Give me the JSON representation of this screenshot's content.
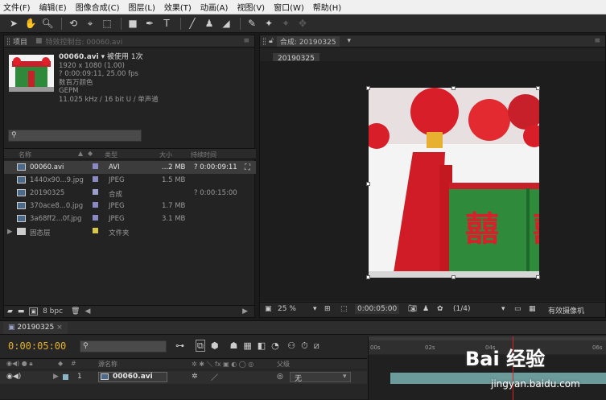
{
  "menubar": {
    "items": [
      "文件(F)",
      "编辑(E)",
      "图像合成(C)",
      "图层(L)",
      "效果(T)",
      "动画(A)",
      "视图(V)",
      "窗口(W)",
      "帮助(H)"
    ]
  },
  "toolbar": {
    "tools": [
      "selection-tool-icon",
      "hand-tool-icon",
      "zoom-tool-icon",
      "rotate-tool-icon",
      "camera-tool-icon",
      "pan-behind-tool-icon",
      "rectangle-tool-icon",
      "pen-tool-icon",
      "type-tool-icon",
      "brush-tool-icon",
      "clone-stamp-tool-icon",
      "eraser-tool-icon",
      "roto-brush-tool-icon",
      "puppet-tool-icon"
    ],
    "type_glyph": "T"
  },
  "project": {
    "tab_project": "项目",
    "tab_effects": "特效控制台: 00060.avi",
    "selected": {
      "name": "00060.avi",
      "used": "▾ 被使用 1次",
      "lines": [
        "1920 x 1080 (1.00)",
        "? 0:00:09:11, 25.00 fps",
        "数百万颜色",
        "GEPM",
        "11.025 kHz / 16 bit U / 单声道"
      ]
    },
    "search_icon": "search-icon",
    "columns": {
      "name": "名称",
      "type": "类型",
      "size": "大小",
      "duration": "持续时间"
    },
    "items": [
      {
        "name": "00060.avi",
        "type": "AVI",
        "size": "...2 MB",
        "duration": "? 0:00:09:11",
        "color": "#8a8ac0"
      },
      {
        "name": "1440x90...9.jpg",
        "type": "JPEG",
        "size": "1.5 MB",
        "duration": "",
        "color": "#8a8ac0"
      },
      {
        "name": "20190325",
        "type": "合成",
        "size": "",
        "duration": "? 0:00:15:00",
        "color": "#9aa0c8"
      },
      {
        "name": "370ace8...0.jpg",
        "type": "JPEG",
        "size": "1.7 MB",
        "duration": "",
        "color": "#8a8ac0"
      },
      {
        "name": "3a68ff2...0f.jpg",
        "type": "JPEG",
        "size": "3.1 MB",
        "duration": "",
        "color": "#8a8ac0"
      },
      {
        "name": "固态层",
        "type": "文件夹",
        "size": "",
        "duration": "",
        "color": "#d8c84a"
      }
    ],
    "bpc": "8 bpc"
  },
  "comp": {
    "tab": "合成: 20190325",
    "comp_name": "20190325",
    "zoom": "25 %",
    "timecode": "0:00:05:00",
    "resolution": "(1/4)",
    "camera": "有效摄像机",
    "decor_text": "囍"
  },
  "timeline": {
    "tab": "20190325",
    "timecode": "0:00:05:00",
    "ruler": [
      "00s",
      "02s",
      "04s",
      "06s"
    ],
    "layer_header": "源名称",
    "parent_header": "父级",
    "layer_index": "1",
    "layer_name": "00060.avi",
    "parent_value": "无"
  },
  "watermark": {
    "brand": "Bai 经验",
    "url": "jingyan.baidu.com"
  }
}
